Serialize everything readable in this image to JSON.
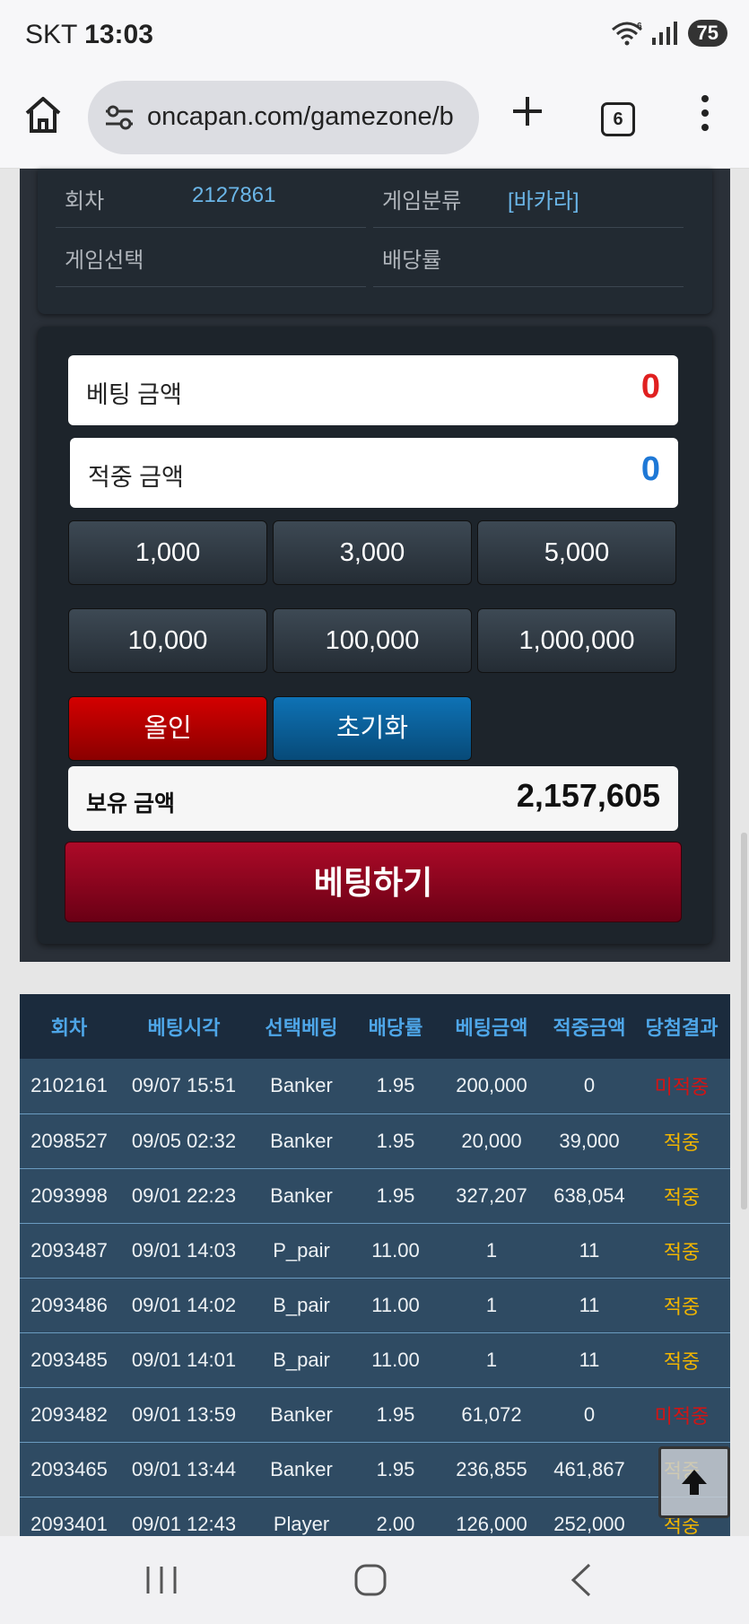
{
  "status": {
    "carrier": "SKT",
    "time": "13:03",
    "wifi_badge": "6",
    "battery": "75"
  },
  "browser": {
    "url": "oncapan.com/gamezone/b",
    "tab_count": "6"
  },
  "info": {
    "round_label": "회차",
    "round_value": "2127861",
    "category_label": "게임분류",
    "category_value": "[바카라]",
    "select_label": "게임선택",
    "select_value": "",
    "odds_label": "배당률",
    "odds_value": ""
  },
  "bet": {
    "bet_amount_label": "베팅 금액",
    "bet_amount_value": "0",
    "win_amount_label": "적중 금액",
    "win_amount_value": "0",
    "chips": [
      "1,000",
      "3,000",
      "5,000",
      "10,000",
      "100,000",
      "1,000,000"
    ],
    "allin_label": "올인",
    "reset_label": "초기화",
    "balance_label": "보유 금액",
    "balance_value": "2,157,605",
    "submit_label": "베팅하기",
    "colors": {
      "bet_amount": "#e02020",
      "win_amount": "#1e78d6"
    }
  },
  "history": {
    "headers": [
      "회차",
      "베팅시각",
      "선택베팅",
      "배당률",
      "베팅금액",
      "적중금액",
      "당첨결과"
    ],
    "rows": [
      [
        "2102161",
        "09/07 15:51",
        "Banker",
        "1.95",
        "200,000",
        "0",
        "미적중"
      ],
      [
        "2098527",
        "09/05 02:32",
        "Banker",
        "1.95",
        "20,000",
        "39,000",
        "적중"
      ],
      [
        "2093998",
        "09/01 22:23",
        "Banker",
        "1.95",
        "327,207",
        "638,054",
        "적중"
      ],
      [
        "2093487",
        "09/01 14:03",
        "P_pair",
        "11.00",
        "1",
        "11",
        "적중"
      ],
      [
        "2093486",
        "09/01 14:02",
        "B_pair",
        "11.00",
        "1",
        "11",
        "적중"
      ],
      [
        "2093485",
        "09/01 14:01",
        "B_pair",
        "11.00",
        "1",
        "11",
        "적중"
      ],
      [
        "2093482",
        "09/01 13:59",
        "Banker",
        "1.95",
        "61,072",
        "0",
        "미적중"
      ],
      [
        "2093465",
        "09/01 13:44",
        "Banker",
        "1.95",
        "236,855",
        "461,867",
        "적중"
      ],
      [
        "2093401",
        "09/01 12:43",
        "Player",
        "2.00",
        "126,000",
        "252,000",
        "적중"
      ]
    ]
  }
}
